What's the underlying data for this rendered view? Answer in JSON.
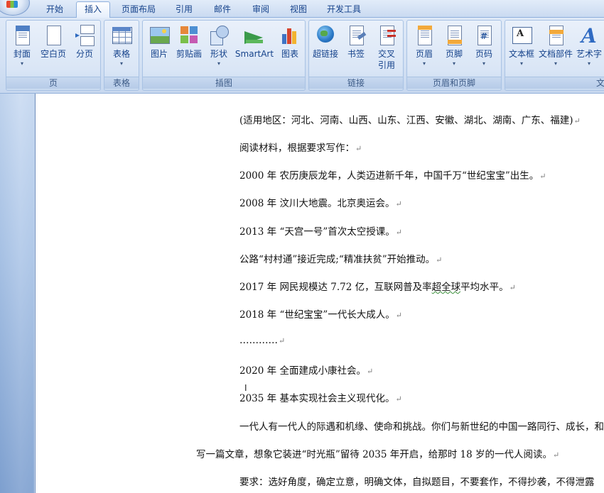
{
  "tabs": [
    "开始",
    "插入",
    "页面布局",
    "引用",
    "邮件",
    "审阅",
    "视图",
    "开发工具"
  ],
  "active_tab": "插入",
  "ribbon": {
    "groups": {
      "pages": {
        "label": "页",
        "buttons": [
          "封面",
          "空白页",
          "分页"
        ]
      },
      "tables": {
        "label": "表格",
        "buttons": [
          "表格"
        ]
      },
      "illustrations": {
        "label": "插图",
        "buttons": [
          "图片",
          "剪贴画",
          "形状",
          "SmartArt",
          "图表"
        ]
      },
      "links": {
        "label": "链接",
        "buttons": [
          "超链接",
          "书签",
          "交叉",
          "引用"
        ]
      },
      "header_footer": {
        "label": "页眉和页脚",
        "buttons": [
          "页眉",
          "页脚",
          "页码"
        ]
      },
      "text": {
        "label": "文",
        "buttons": [
          "文本框",
          "文档部件",
          "艺术字"
        ]
      }
    },
    "dropdown_arrow": "▾"
  },
  "document": {
    "lines": [
      "(适用地区：河北、河南、山西、山东、江西、安徽、湖北、湖南、广东、福建)",
      "阅读材料，根据要求写作：",
      "2000 年  农历庚辰龙年，人类迈进新千年，中国千万“世纪宝宝”出生。",
      "2008 年  汶川大地震。北京奥运会。",
      "2013 年  “天宫一号”首次太空授课。",
      "公路“村村通”接近完成;“精准扶贫”开始推动。",
      "2017 年  网民规模达 7.72 亿，互联网普及率",
      "超全球",
      "平均水平。",
      "2018 年  “世纪宝宝”一代长大成人。",
      "…………",
      "2020 年  全面建成小康社会。",
      "2035 年  基本实现社会主义现代化。",
      "一代人有一代人的际遇和机缘、使命和挑战。你们与新世纪的中国一路同行、成长，和",
      "写一篇文章，想象它装进“时光瓶”留待 2035 年开启，给那时 18 岁的一代人阅读。",
      "要求：选好角度，确定立意，明确文体，自拟题目，不要套作，不得抄袭，不得泄露"
    ],
    "paragraph_mark": "↵",
    "cursor_glyph": "I"
  }
}
